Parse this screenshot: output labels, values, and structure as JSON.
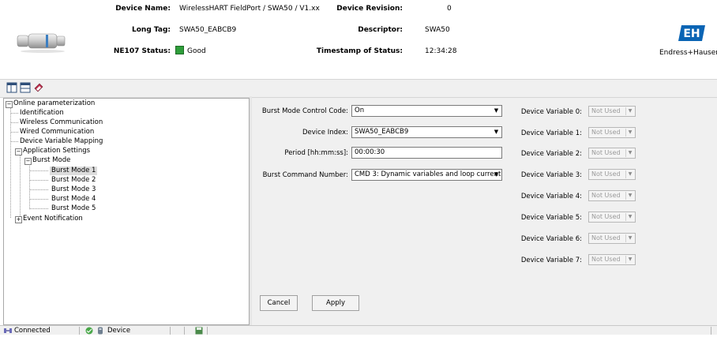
{
  "header": {
    "device_name_label": "Device Name:",
    "device_name": "WirelessHART FieldPort / SWA50 / V1.xx",
    "long_tag_label": "Long Tag:",
    "long_tag": "SWA50_EABCB9",
    "ne107_label": "NE107 Status:",
    "ne107_value": "Good",
    "ne107_color": "#2e9e3a",
    "device_revision_label": "Device Revision:",
    "device_revision": "0",
    "descriptor_label": "Descriptor:",
    "descriptor": "SWA50",
    "timestamp_label": "Timestamp of Status:",
    "timestamp": "12:34:28",
    "brand_name": "Endress+Hauser",
    "brand_color": "#0a64b4"
  },
  "toolbar": {
    "icons": [
      "layout-icon",
      "window-icon",
      "book-icon"
    ]
  },
  "tree": {
    "items": [
      {
        "label": "Online parameterization"
      },
      {
        "label": "Identification"
      },
      {
        "label": "Wireless Communication"
      },
      {
        "label": "Wired Communication"
      },
      {
        "label": "Device Variable Mapping"
      },
      {
        "label": "Application Settings"
      },
      {
        "label": "Burst Mode"
      },
      {
        "label": "Burst Mode 1"
      },
      {
        "label": "Burst Mode 2"
      },
      {
        "label": "Burst Mode 3"
      },
      {
        "label": "Burst Mode 4"
      },
      {
        "label": "Burst Mode 5"
      },
      {
        "label": "Event Notification"
      }
    ]
  },
  "form": {
    "burst_mode_control_code_label": "Burst Mode Control Code:",
    "burst_mode_control_code": "On",
    "device_index_label": "Device Index:",
    "device_index": "SWA50_EABCB9",
    "period_label": "Period [hh:mm:ss]:",
    "period": "00:00:30",
    "burst_command_number_label": "Burst Command Number:",
    "burst_command_number": "CMD 3: Dynamic variables and loop current",
    "cancel_label": "Cancel",
    "apply_label": "Apply"
  },
  "device_variables": [
    {
      "label": "Device Variable 0:",
      "value": "Not Used"
    },
    {
      "label": "Device Variable 1:",
      "value": "Not Used"
    },
    {
      "label": "Device Variable 2:",
      "value": "Not Used"
    },
    {
      "label": "Device Variable 3:",
      "value": "Not Used"
    },
    {
      "label": "Device Variable 4:",
      "value": "Not Used"
    },
    {
      "label": "Device Variable 5:",
      "value": "Not Used"
    },
    {
      "label": "Device Variable 6:",
      "value": "Not Used"
    },
    {
      "label": "Device Variable 7:",
      "value": "Not Used"
    }
  ],
  "statusbar": {
    "connection": "Connected",
    "mode": "Device"
  }
}
